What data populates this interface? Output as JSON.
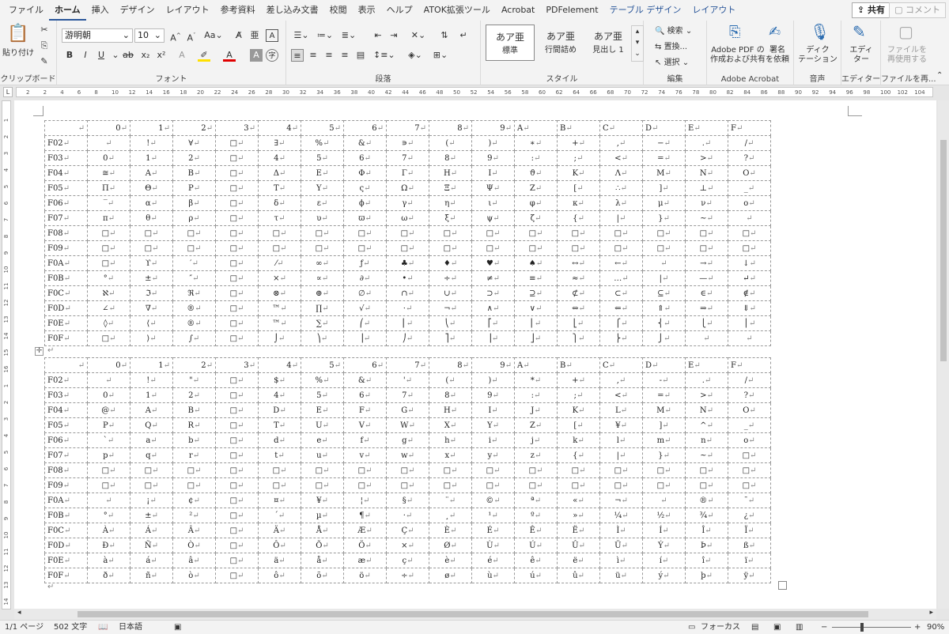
{
  "menu": {
    "tabs": [
      "ファイル",
      "ホーム",
      "挿入",
      "デザイン",
      "レイアウト",
      "参考資料",
      "差し込み文書",
      "校閲",
      "表示",
      "ヘルプ",
      "ATOK拡張ツール",
      "Acrobat",
      "PDFelement",
      "テーブル デザイン",
      "レイアウト"
    ],
    "active": 1,
    "contextual": [
      13,
      14
    ],
    "share": "共有",
    "comment": "コメント"
  },
  "ribbon": {
    "clipboard": {
      "paste": "貼り付け",
      "label": "クリップボード"
    },
    "font": {
      "name": "游明朝",
      "size": "10",
      "label": "フォント"
    },
    "paragraph": {
      "label": "段落"
    },
    "styles": {
      "items": [
        {
          "sample": "あア亜",
          "name": "標準"
        },
        {
          "sample": "あア亜",
          "name": "行間詰め"
        },
        {
          "sample": "あア亜",
          "name": "見出し 1"
        }
      ],
      "label": "スタイル"
    },
    "editing": {
      "find": "検索",
      "replace": "置換...",
      "select": "選択",
      "label": "編集"
    },
    "acrobat": {
      "create": "Adobe PDF の",
      "create2": "作成および共有",
      "sign": "署名",
      "sign2": "を依頼",
      "label": "Adobe Acrobat"
    },
    "voice": {
      "dictate": "ディク",
      "dictate2": "テーション",
      "label": "音声"
    },
    "editor": {
      "name": "エディ",
      "name2": "ター",
      "label": "エディター"
    },
    "reuse": {
      "name": "ファイルを",
      "name2": "再使用する",
      "label": "ファイルを再..."
    }
  },
  "ruler": {
    "h": [
      "2",
      "2",
      "4",
      "6",
      "8",
      "10",
      "12",
      "14",
      "16",
      "18",
      "20",
      "22",
      "24",
      "26",
      "28",
      "30",
      "32",
      "34",
      "36",
      "38",
      "40",
      "42",
      "44",
      "46",
      "48",
      "50",
      "52",
      "54",
      "56",
      "58",
      "60",
      "62",
      "64",
      "66",
      "68",
      "70",
      "72",
      "74",
      "76",
      "78",
      "80",
      "82",
      "84",
      "86",
      "88",
      "90",
      "92",
      "94",
      "96",
      "98",
      "100",
      "102",
      "104"
    ],
    "v": [
      "1",
      "2",
      "3",
      "4",
      "5",
      "6",
      "7",
      "8",
      "9",
      "10",
      "11",
      "12",
      "13",
      "14",
      "15",
      "16",
      "1",
      "2",
      "3",
      "4",
      "5",
      "6",
      "7",
      "8",
      "9",
      "10",
      "11",
      "12",
      "13",
      "14"
    ]
  },
  "table1": {
    "header": [
      "0",
      "1",
      "2",
      "3",
      "4",
      "5",
      "6",
      "7",
      "8",
      "9",
      "A",
      "B",
      "C",
      "D",
      "E",
      "F"
    ],
    "rows": [
      [
        "F02",
        "",
        "!",
        "∀",
        "□",
        "∃",
        "%",
        "&",
        "∍",
        "(",
        ")",
        "∗",
        "+",
        ",",
        "−",
        ".",
        "/"
      ],
      [
        "F03",
        "0",
        "1",
        "2",
        "□",
        "4",
        "5",
        "6",
        "7",
        "8",
        "9",
        ":",
        ";",
        "<",
        "=",
        ">",
        "?"
      ],
      [
        "F04",
        "≅",
        "Α",
        "Β",
        "□",
        "Δ",
        "Ε",
        "Φ",
        "Γ",
        "Η",
        "Ι",
        "ϑ",
        "Κ",
        "Λ",
        "Μ",
        "Ν",
        "Ο"
      ],
      [
        "F05",
        "Π",
        "Θ",
        "Ρ",
        "□",
        "Τ",
        "Υ",
        "ς",
        "Ω",
        "Ξ",
        "Ψ",
        "Ζ",
        "[",
        "∴",
        "]",
        "⊥",
        "_"
      ],
      [
        "F06",
        "‾",
        "α",
        "β",
        "□",
        "δ",
        "ε",
        "ϕ",
        "γ",
        "η",
        "ι",
        "φ",
        "κ",
        "λ",
        "μ",
        "ν",
        "ο"
      ],
      [
        "F07",
        "π",
        "θ",
        "ρ",
        "□",
        "τ",
        "υ",
        "ϖ",
        "ω",
        "ξ",
        "ψ",
        "ζ",
        "{",
        "|",
        "}",
        "∼",
        ""
      ],
      [
        "F08",
        "□",
        "□",
        "□",
        "□",
        "□",
        "□",
        "□",
        "□",
        "□",
        "□",
        "□",
        "□",
        "□",
        "□",
        "□",
        "□"
      ],
      [
        "F09",
        "□",
        "□",
        "□",
        "□",
        "□",
        "□",
        "□",
        "□",
        "□",
        "□",
        "□",
        "□",
        "□",
        "□",
        "□",
        "□"
      ],
      [
        "F0A",
        "□",
        "ϒ",
        "′",
        "□",
        "⁄",
        "∞",
        "ƒ",
        "♣",
        "♦",
        "♥",
        "♠",
        "↔",
        "←",
        "",
        "→",
        "↓"
      ],
      [
        "F0B",
        "°",
        "±",
        "″",
        "□",
        "×",
        "∝",
        "∂",
        "•",
        "÷",
        "≠",
        "≡",
        "≈",
        "…",
        "|",
        "—",
        "↵"
      ],
      [
        "F0C",
        "ℵ",
        "ℑ",
        "ℜ",
        "□",
        "⊗",
        "⊕",
        "∅",
        "∩",
        "∪",
        "⊃",
        "⊇",
        "⊄",
        "⊂",
        "⊆",
        "∈",
        "∉"
      ],
      [
        "F0D",
        "∠",
        "∇",
        "®",
        "□",
        "™",
        "∏",
        "√",
        "⋅",
        "¬",
        "∧",
        "∨",
        "⇔",
        "⇐",
        "⇑",
        "⇒",
        "⇓"
      ],
      [
        "F0E",
        "◊",
        "⟨",
        "®",
        "□",
        "™",
        "∑",
        "⎛",
        "⎜",
        "⎝",
        "⎡",
        "⎢",
        "⎣",
        "⎧",
        "⎨",
        "⎩",
        "⎪"
      ],
      [
        "F0F",
        "□",
        "⟩",
        "∫",
        "□",
        "⌡",
        "⎞",
        "⎟",
        "⎠",
        "⎤",
        "⎥",
        "⎦",
        "⎫",
        "⎬",
        "⎭",
        "",
        ""
      ]
    ]
  },
  "table2": {
    "header": [
      "0",
      "1",
      "2",
      "3",
      "4",
      "5",
      "6",
      "7",
      "8",
      "9",
      "A",
      "B",
      "C",
      "D",
      "E",
      "F"
    ],
    "rows": [
      [
        "F02",
        "",
        "!",
        "\"",
        "□",
        "$",
        "%",
        "&",
        "'",
        "(",
        ")",
        "*",
        "+",
        ",",
        "-",
        ".",
        "/"
      ],
      [
        "F03",
        "0",
        "1",
        "2",
        "□",
        "4",
        "5",
        "6",
        "7",
        "8",
        "9",
        ":",
        ";",
        "<",
        "=",
        ">",
        "?"
      ],
      [
        "F04",
        "@",
        "A",
        "B",
        "□",
        "D",
        "E",
        "F",
        "G",
        "H",
        "I",
        "J",
        "K",
        "L",
        "M",
        "N",
        "O"
      ],
      [
        "F05",
        "P",
        "Q",
        "R",
        "□",
        "T",
        "U",
        "V",
        "W",
        "X",
        "Y",
        "Z",
        "[",
        "¥",
        "]",
        "^",
        "_"
      ],
      [
        "F06",
        "`",
        "a",
        "b",
        "□",
        "d",
        "e",
        "f",
        "g",
        "h",
        "i",
        "j",
        "k",
        "l",
        "m",
        "n",
        "o"
      ],
      [
        "F07",
        "p",
        "q",
        "r",
        "□",
        "t",
        "u",
        "v",
        "w",
        "x",
        "y",
        "z",
        "{",
        "|",
        "}",
        "~",
        "□"
      ],
      [
        "F08",
        "□",
        "□",
        "□",
        "□",
        "□",
        "□",
        "□",
        "□",
        "□",
        "□",
        "□",
        "□",
        "□",
        "□",
        "□",
        "□"
      ],
      [
        "F09",
        "□",
        "□",
        "□",
        "□",
        "□",
        "□",
        "□",
        "□",
        "□",
        "□",
        "□",
        "□",
        "□",
        "□",
        "□",
        "□"
      ],
      [
        "F0A",
        "",
        "¡",
        "¢",
        "□",
        "¤",
        "¥",
        "¦",
        "§",
        "¨",
        "©",
        "ª",
        "«",
        "¬",
        "",
        "®",
        "¯"
      ],
      [
        "F0B",
        "°",
        "±",
        "²",
        "□",
        "´",
        "µ",
        "¶",
        "·",
        "¸",
        "¹",
        "º",
        "»",
        "¼",
        "½",
        "¾",
        "¿"
      ],
      [
        "F0C",
        "À",
        "Á",
        "Â",
        "□",
        "Ä",
        "Å",
        "Æ",
        "Ç",
        "È",
        "É",
        "Ê",
        "Ë",
        "Ì",
        "Í",
        "Î",
        "Ï"
      ],
      [
        "F0D",
        "Ð",
        "Ñ",
        "Ò",
        "□",
        "Ô",
        "Õ",
        "Ö",
        "×",
        "Ø",
        "Ù",
        "Ú",
        "Û",
        "Ü",
        "Ý",
        "Þ",
        "ß"
      ],
      [
        "F0E",
        "à",
        "á",
        "â",
        "□",
        "ä",
        "å",
        "æ",
        "ç",
        "è",
        "é",
        "ê",
        "ë",
        "ì",
        "í",
        "î",
        "ï"
      ],
      [
        "F0F",
        "ð",
        "ñ",
        "ò",
        "□",
        "ô",
        "õ",
        "ö",
        "÷",
        "ø",
        "ù",
        "ú",
        "û",
        "ü",
        "ý",
        "þ",
        "ÿ"
      ]
    ]
  },
  "status": {
    "page": "1/1 ページ",
    "words": "502 文字",
    "lang": "日本語",
    "focus": "フォーカス",
    "zoom": "90%"
  }
}
